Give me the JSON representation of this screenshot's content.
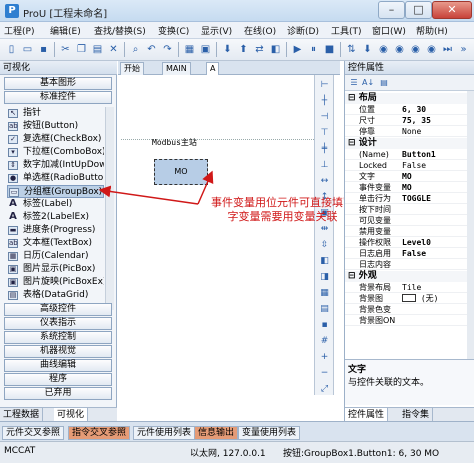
{
  "window": {
    "title": "ProU [工程未命名]"
  },
  "menu": [
    "工程(P)",
    "编辑(E)",
    "查找/替换(S)",
    "变换(C)",
    "显示(V)",
    "在线(O)",
    "诊断(D)",
    "工具(T)",
    "窗口(W)",
    "帮助(H)"
  ],
  "left_panel": {
    "title": "可视化",
    "categories_top": [
      "基本图形",
      "标准控件"
    ],
    "items": [
      {
        "label": "指针",
        "icon": "pointer-icon"
      },
      {
        "label": "按钮(Button)",
        "icon": "button-icon"
      },
      {
        "label": "复选框(CheckBox)",
        "icon": "checkbox-icon"
      },
      {
        "label": "下拉框(ComboBox)",
        "icon": "combobox-icon"
      },
      {
        "label": "数字加减(IntUpDown)",
        "icon": "updown-icon"
      },
      {
        "label": "单选框(RadioButton)",
        "icon": "radio-icon"
      },
      {
        "label": "分组框(GroupBox)",
        "icon": "groupbox-icon"
      },
      {
        "label": "标签(Label)",
        "icon": "label-icon"
      },
      {
        "label": "标签2(LabelEx)",
        "icon": "label-icon"
      },
      {
        "label": "进度条(Progress)",
        "icon": "progress-icon"
      },
      {
        "label": "文本框(TextBox)",
        "icon": "textbox-icon"
      },
      {
        "label": "日历(Calendar)",
        "icon": "calendar-icon"
      },
      {
        "label": "图片显示(PicBox)",
        "icon": "picture-icon"
      },
      {
        "label": "图片旋映(PicBoxEx)",
        "icon": "picture-icon"
      },
      {
        "label": "表格(DataGrid)",
        "icon": "grid-icon"
      }
    ],
    "selected_index": 6,
    "categories_bottom": [
      "高级控件",
      "仪表指示",
      "系统控制",
      "机器视觉",
      "曲线编辑",
      "程序",
      "已弃用"
    ],
    "tabs": [
      "工程数据",
      "可视化"
    ]
  },
  "doc_tabs": [
    "开始",
    "MAIN",
    "A"
  ],
  "canvas": {
    "group_label": "Modbus主站",
    "button_text": "MO",
    "annotation_line1": "事件变量用位元件可直接填写",
    "annotation_line2": "字变量需要用变量关联"
  },
  "right_panel": {
    "title": "控件属性",
    "sections": [
      {
        "name": "布局",
        "rows": [
          {
            "k": "位置",
            "v": "6, 30"
          },
          {
            "k": "尺寸",
            "v": "75, 35"
          },
          {
            "k": "停靠",
            "v": "None"
          }
        ]
      },
      {
        "name": "设计",
        "rows": [
          {
            "k": "(Name)",
            "v": "Button1"
          },
          {
            "k": "Locked",
            "v": "False"
          },
          {
            "k": "文字",
            "v": "MO"
          },
          {
            "k": "事件变量",
            "v": "MO"
          },
          {
            "k": "单击行为",
            "v": "TOGGLE"
          },
          {
            "k": "按下时间",
            "v": ""
          },
          {
            "k": "可见变量",
            "v": ""
          },
          {
            "k": "禁用变量",
            "v": ""
          },
          {
            "k": "操作权限",
            "v": "Level0"
          },
          {
            "k": "日志启用",
            "v": "False"
          },
          {
            "k": "日志内容",
            "v": ""
          }
        ]
      },
      {
        "name": "外观",
        "rows": [
          {
            "k": "背景布局",
            "v": "Tile"
          },
          {
            "k": "背景图",
            "v": "(无)"
          },
          {
            "k": "背景色变",
            "v": ""
          },
          {
            "k": "背景图ON",
            "v": ""
          }
        ]
      }
    ],
    "desc_title": "文字",
    "desc_text": "与控件关联的文本。",
    "tabs": [
      "控件属性",
      "指令集"
    ]
  },
  "bottom_tabs": [
    "元件交叉参照",
    "指令交叉参照",
    "元件使用列表",
    "信息输出",
    "变量使用列表"
  ],
  "status": {
    "left": "MCCAT",
    "network": "以太网, 127.0.0.1",
    "selection": "按钮:GroupBox1.Button1: 6, 30 MO"
  }
}
